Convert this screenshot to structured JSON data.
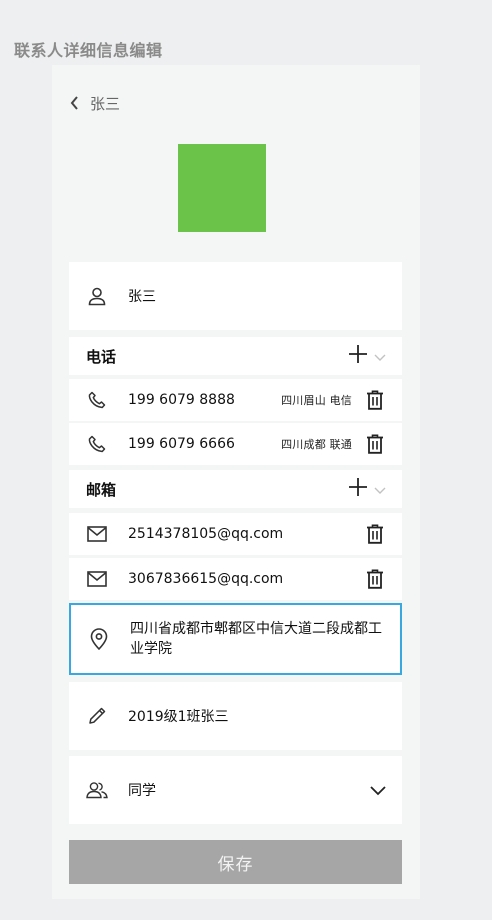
{
  "page_title": "联系人详细信息编辑",
  "header": {
    "name": "张三"
  },
  "colors": {
    "avatar": "#6cc34a",
    "accent": "#3aa8e0",
    "save_bg": "#a6a6a6"
  },
  "name_field": {
    "value": "张三"
  },
  "phone_section": {
    "title": "电话"
  },
  "phones": [
    {
      "number": "199 6079 8888",
      "location": "四川眉山 电信"
    },
    {
      "number": "199 6079 6666",
      "location": "四川成都 联通"
    }
  ],
  "email_section": {
    "title": "邮箱"
  },
  "emails": [
    {
      "address": "2514378105@qq.com"
    },
    {
      "address": "3067836615@qq.com"
    }
  ],
  "address": {
    "value": "四川省成都市郫都区中信大道二段成都工业学院"
  },
  "note": {
    "value": "2019级1班张三"
  },
  "group": {
    "value": "同学"
  },
  "save_label": "保存"
}
